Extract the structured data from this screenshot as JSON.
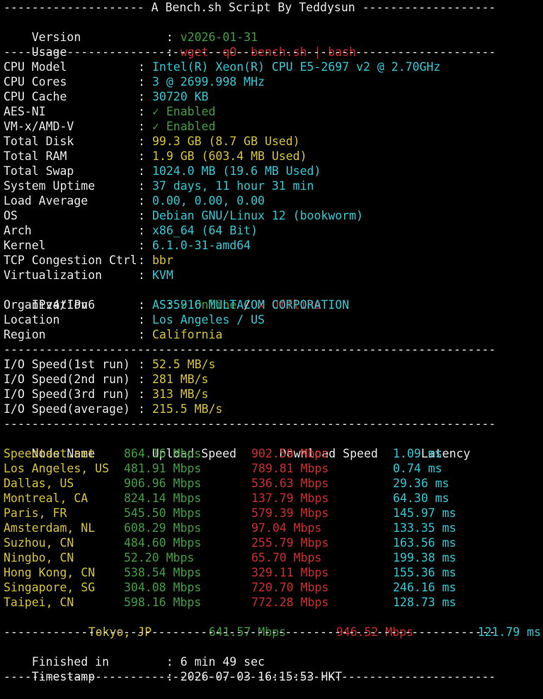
{
  "header": {
    "title_line": "-------------------- A Bench.sh Script By Teddysun -------------------",
    "version_key": "Version",
    "version_value": "v2026-01-31",
    "usage_key": "Usage",
    "usage_value": "wget -qO- bench.sh | bash"
  },
  "separator": "----------------------------------------------------------------------",
  "colon": ":",
  "system": [
    {
      "key": "CPU Model",
      "value": "Intel(R) Xeon(R) CPU E5-2697 v2 @ 2.70GHz",
      "color": "c"
    },
    {
      "key": "CPU Cores",
      "value": "3 @ 2699.998 MHz",
      "color": "c"
    },
    {
      "key": "CPU Cache",
      "value": "30720 KB",
      "color": "c"
    },
    {
      "key": "AES-NI",
      "value": "✓ Enabled",
      "color": "g"
    },
    {
      "key": "VM-x/AMD-V",
      "value": "✓ Enabled",
      "color": "g"
    },
    {
      "key": "Total Disk",
      "value": "99.3 GB (8.7 GB Used)",
      "color": "y"
    },
    {
      "key": "Total RAM",
      "value": "1.9 GB (603.4 MB Used)",
      "color": "y"
    },
    {
      "key": "Total Swap",
      "value": "1024.0 MB (19.6 MB Used)",
      "color": "c"
    },
    {
      "key": "System Uptime",
      "value": "37 days, 11 hour 31 min",
      "color": "c"
    },
    {
      "key": "Load Average",
      "value": "0.00, 0.00, 0.00",
      "color": "c"
    },
    {
      "key": "OS",
      "value": "Debian GNU/Linux 12 (bookworm)",
      "color": "c"
    },
    {
      "key": "Arch",
      "value": "x86_64 (64 Bit)",
      "color": "c"
    },
    {
      "key": "Kernel",
      "value": "6.1.0-31-amd64",
      "color": "c"
    },
    {
      "key": "TCP Congestion Ctrl",
      "value": "bbr",
      "color": "y"
    },
    {
      "key": "Virtualization",
      "value": "KVM",
      "color": "c"
    }
  ],
  "ip": {
    "key": "IPv4/IPv6",
    "v4": "✓ Online",
    "slash": " / ",
    "v6": "✗ Offline"
  },
  "location": [
    {
      "key": "Organization",
      "value": "AS35916 MULTACOM CORPORATION",
      "color": "c"
    },
    {
      "key": "Location",
      "value": "Los Angeles / US",
      "color": "c"
    },
    {
      "key": "Region",
      "value": "California",
      "color": "y"
    }
  ],
  "io": [
    {
      "key": "I/O Speed(1st run)",
      "value": "52.5 MB/s"
    },
    {
      "key": "I/O Speed(2nd run)",
      "value": "281 MB/s"
    },
    {
      "key": "I/O Speed(3rd run)",
      "value": "313 MB/s"
    },
    {
      "key": "I/O Speed(average)",
      "value": "215.5 MB/s"
    }
  ],
  "speedtest": {
    "headers": [
      "Node Name",
      "Upload Speed",
      "Download Speed",
      "Latency"
    ],
    "rows": [
      {
        "node": "Speedtest.net",
        "up": "864.16 Mbps",
        "down": "902.59 Mbps",
        "lat": "1.09 ms"
      },
      {
        "node": "Los Angeles, US",
        "up": "481.91 Mbps",
        "down": "789.81 Mbps",
        "lat": "0.74 ms"
      },
      {
        "node": "Dallas, US",
        "up": "906.96 Mbps",
        "down": "536.63 Mbps",
        "lat": "29.36 ms"
      },
      {
        "node": "Montreal, CA",
        "up": "824.14 Mbps",
        "down": "137.79 Mbps",
        "lat": "64.30 ms"
      },
      {
        "node": "Paris, FR",
        "up": "545.50 Mbps",
        "down": "579.39 Mbps",
        "lat": "145.97 ms"
      },
      {
        "node": "Amsterdam, NL",
        "up": "608.29 Mbps",
        "down": "97.04 Mbps",
        "lat": "133.35 ms"
      },
      {
        "node": "Suzhou, CN",
        "up": "484.60 Mbps",
        "down": "255.79 Mbps",
        "lat": "163.56 ms"
      },
      {
        "node": "Ningbo, CN",
        "up": "52.20 Mbps",
        "down": "65.70 Mbps",
        "lat": "199.38 ms"
      },
      {
        "node": "Hong Kong, CN",
        "up": "538.54 Mbps",
        "down": "329.11 Mbps",
        "lat": "155.36 ms"
      },
      {
        "node": "Singapore, SG",
        "up": "304.08 Mbps",
        "down": "720.70 Mbps",
        "lat": "246.16 ms"
      },
      {
        "node": "Taipei, CN",
        "up": "598.16 Mbps",
        "down": "772.28 Mbps",
        "lat": "128.73 ms"
      }
    ],
    "tokyo": {
      "node": "Tokyo, JP",
      "up": "641.57 Mbps",
      "down": "946.52 Mbps",
      "lat": "121.79 ms"
    }
  },
  "footer": {
    "finished_key": "Finished in",
    "finished_value": "6 min 49 sec",
    "timestamp_key": "Timestamp",
    "timestamp_value": "2026-07-03 16:15:53 HKT"
  }
}
